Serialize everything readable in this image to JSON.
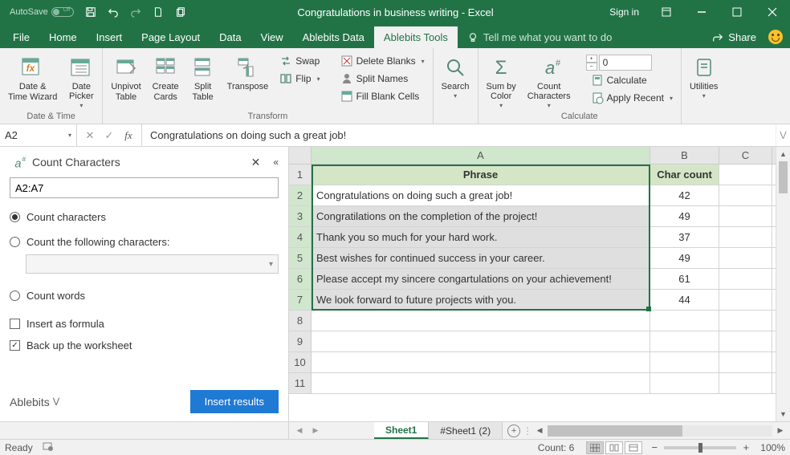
{
  "titlebar": {
    "autosave_label": "AutoSave",
    "autosave_state": "Off",
    "title": "Congratulations in business writing  -  Excel",
    "signin": "Sign in"
  },
  "tabs": {
    "file": "File",
    "home": "Home",
    "insert": "Insert",
    "pagelayout": "Page Layout",
    "data": "Data",
    "view": "View",
    "ablebits_data": "Ablebits Data",
    "ablebits_tools": "Ablebits Tools",
    "tellme": "Tell me what you want to do",
    "share": "Share"
  },
  "ribbon": {
    "groups": {
      "datetime": {
        "label": "Date & Time",
        "date_time_wizard": "Date &\nTime Wizard",
        "date_picker": "Date\nPicker"
      },
      "transform": {
        "label": "Transform",
        "unpivot": "Unpivot\nTable",
        "create_cards": "Create\nCards",
        "split_table": "Split\nTable",
        "transpose": "Transpose",
        "swap": "Swap",
        "flip": "Flip",
        "delete_blanks": "Delete Blanks",
        "split_names": "Split Names",
        "fill_blank": "Fill Blank Cells"
      },
      "search": {
        "search": "Search"
      },
      "calculate": {
        "label": "Calculate",
        "sum_by_color": "Sum by\nColor",
        "count_chars": "Count\nCharacters",
        "num_value": "0",
        "calculate": "Calculate",
        "apply_recent": "Apply Recent"
      },
      "utilities": {
        "utilities": "Utilities"
      }
    }
  },
  "formula_bar": {
    "namebox": "A2",
    "content": "Congratulations on doing such a great job!"
  },
  "panel": {
    "title": "Count Characters",
    "range": "A2:A7",
    "opt_count_chars": "Count characters",
    "opt_count_following": "Count the following characters:",
    "opt_count_words": "Count words",
    "chk_insert_formula": "Insert as formula",
    "chk_backup": "Back up the worksheet",
    "ablebits_link": "Ablebits",
    "insert_btn": "Insert results"
  },
  "grid": {
    "col_a": "A",
    "col_b": "B",
    "col_c": "C",
    "hdr_phrase": "Phrase",
    "hdr_count": "Char count",
    "rows": [
      {
        "n": "1"
      },
      {
        "n": "2",
        "a": "Congratulations on doing such a great job!",
        "b": "42"
      },
      {
        "n": "3",
        "a": "Congratilations on the completion of the project!",
        "b": "49"
      },
      {
        "n": "4",
        "a": "Thank you so much for your hard work.",
        "b": "37"
      },
      {
        "n": "5",
        "a": "Best wishes for continued success in your career.",
        "b": "49"
      },
      {
        "n": "6",
        "a": "Please accept my sincere congartulations on your achievement!",
        "b": "61"
      },
      {
        "n": "7",
        "a": "We look forward to future projects with you.",
        "b": "44"
      },
      {
        "n": "8"
      },
      {
        "n": "9"
      },
      {
        "n": "10"
      },
      {
        "n": "11"
      }
    ]
  },
  "sheets": {
    "s1": "Sheet1",
    "s2": "#Sheet1 (2)"
  },
  "status": {
    "ready": "Ready",
    "count": "Count: 6",
    "zoom": "100%"
  }
}
